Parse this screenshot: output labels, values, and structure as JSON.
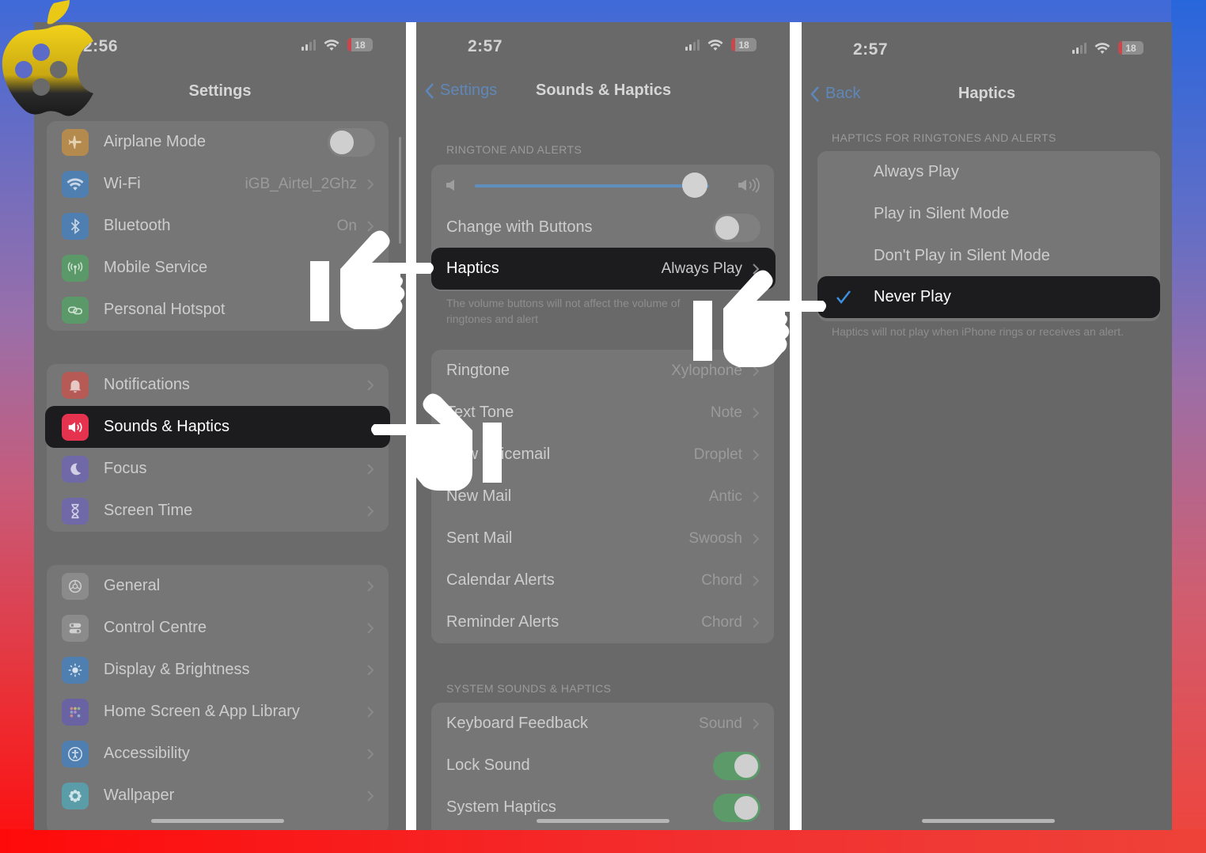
{
  "brand": {
    "logo_icon": "apple-logo-icon",
    "colors": {
      "gold": "#e7c318",
      "dark": "#1f1f1f"
    }
  },
  "colors": {
    "accent_blue": "#5f87b9",
    "selected_row": "#1c1c1e",
    "toggle_on": "#5c9a6a",
    "sounds_icon_bg": "#e5334f"
  },
  "panels": [
    {
      "status": {
        "time": "2:56",
        "battery": "18"
      },
      "title": "Settings",
      "groups": [
        {
          "rows": [
            {
              "label": "Airplane Mode",
              "icon": "airplane-icon",
              "icon_bg": "#b58a4f",
              "toggle": false
            },
            {
              "label": "Wi-Fi",
              "icon": "wifi-icon",
              "icon_bg": "#4f7fb0",
              "value": "iGB_Airtel_2Ghz"
            },
            {
              "label": "Bluetooth",
              "icon": "bluetooth-icon",
              "icon_bg": "#4f7fb0",
              "value": "On"
            },
            {
              "label": "Mobile Service",
              "icon": "antenna-icon",
              "icon_bg": "#5b9a68"
            },
            {
              "label": "Personal Hotspot",
              "icon": "hotspot-link-icon",
              "icon_bg": "#5b9a68"
            }
          ]
        },
        {
          "rows": [
            {
              "label": "Notifications",
              "icon": "bell-icon",
              "icon_bg": "#b55a55"
            },
            {
              "label": "Sounds & Haptics",
              "icon": "speaker-icon",
              "icon_bg": "#e5334f",
              "selected": true
            },
            {
              "label": "Focus",
              "icon": "moon-icon",
              "icon_bg": "#6f6aa7"
            },
            {
              "label": "Screen Time",
              "icon": "hourglass-icon",
              "icon_bg": "#6f6aa7"
            }
          ]
        },
        {
          "rows": [
            {
              "label": "General",
              "icon": "gear-icon",
              "icon_bg": "#8b8b8b"
            },
            {
              "label": "Control Centre",
              "icon": "switches-icon",
              "icon_bg": "#8b8b8b"
            },
            {
              "label": "Display & Brightness",
              "icon": "sun-icon",
              "icon_bg": "#4f7fb0"
            },
            {
              "label": "Home Screen & App Library",
              "icon": "app-grid-icon",
              "icon_bg": "#6a63a3"
            },
            {
              "label": "Accessibility",
              "icon": "accessibility-icon",
              "icon_bg": "#4f7fb0"
            },
            {
              "label": "Wallpaper",
              "icon": "flower-icon",
              "icon_bg": "#5a9ca8"
            }
          ]
        }
      ]
    },
    {
      "status": {
        "time": "2:57",
        "battery": "18"
      },
      "back_label": "Settings",
      "title": "Sounds & Haptics",
      "section1_header": "RINGTONE AND ALERTS",
      "volume_percent": 94,
      "change_with_buttons": {
        "label": "Change with Buttons",
        "toggle": false
      },
      "haptics_row": {
        "label": "Haptics",
        "value": "Always Play",
        "selected": true
      },
      "section1_footer": "The volume buttons will not affect the volume of ringtones and alert",
      "tones": [
        {
          "label": "Ringtone",
          "value": "Xylophone"
        },
        {
          "label": "Text Tone",
          "value": "Note"
        },
        {
          "label": "New Voicemail",
          "value": "Droplet"
        },
        {
          "label": "New Mail",
          "value": "Antic"
        },
        {
          "label": "Sent Mail",
          "value": "Swoosh"
        },
        {
          "label": "Calendar Alerts",
          "value": "Chord"
        },
        {
          "label": "Reminder Alerts",
          "value": "Chord"
        }
      ],
      "section2_header": "SYSTEM SOUNDS & HAPTICS",
      "system": [
        {
          "label": "Keyboard Feedback",
          "value": "Sound"
        },
        {
          "label": "Lock Sound",
          "toggle": true
        },
        {
          "label": "System Haptics",
          "toggle": true
        }
      ]
    },
    {
      "status": {
        "time": "2:57",
        "battery": "18"
      },
      "back_label": "Back",
      "title": "Haptics",
      "section_header": "HAPTICS FOR RINGTONES AND ALERTS",
      "options": [
        {
          "label": "Always Play",
          "checked": false
        },
        {
          "label": "Play in Silent Mode",
          "checked": false
        },
        {
          "label": "Don't Play in Silent Mode",
          "checked": false
        },
        {
          "label": "Never Play",
          "checked": true
        }
      ],
      "footer": "Haptics will not play when iPhone rings or receives an alert."
    }
  ],
  "annotations": [
    {
      "icon": "pointing-hand-right-icon",
      "target": "Haptics"
    },
    {
      "icon": "pointing-hand-left-icon",
      "target": "Sounds & Haptics"
    },
    {
      "icon": "pointing-hand-right-icon",
      "target": "Never Play"
    }
  ]
}
